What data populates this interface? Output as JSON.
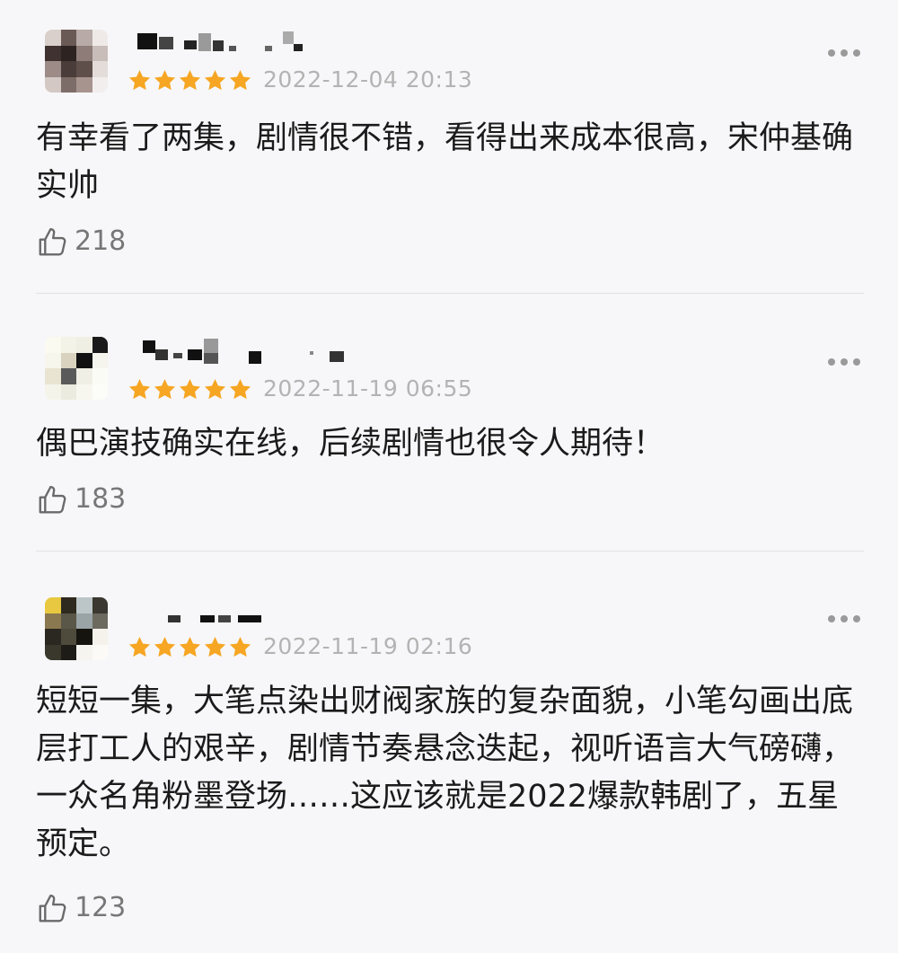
{
  "icons": {
    "star": "star-icon",
    "thumbs_up": "thumbs-up-icon",
    "more": "more-icon"
  },
  "colors": {
    "star": "#f6a623",
    "date": "#b3b3b3",
    "like_count": "#777777"
  },
  "reviews": [
    {
      "rating": 5,
      "date": "2022-12-04 20:13",
      "text": "有幸看了两集，剧情很不错，看得出来成本很高，宋仲基确实帅",
      "likes": "218"
    },
    {
      "rating": 5,
      "date": "2022-11-19 06:55",
      "text": "偶巴演技确实在线，后续剧情也很令人期待！",
      "likes": "183"
    },
    {
      "rating": 5,
      "date": "2022-11-19 02:16",
      "text": "短短一集，大笔点染出财阀家族的复杂面貌，小笔勾画出底层打工人的艰辛，剧情节奏悬念迭起，视听语言大气磅礴，一众名角粉墨登场……这应该就是2022爆款韩剧了，五星预定。",
      "likes": "123"
    }
  ]
}
